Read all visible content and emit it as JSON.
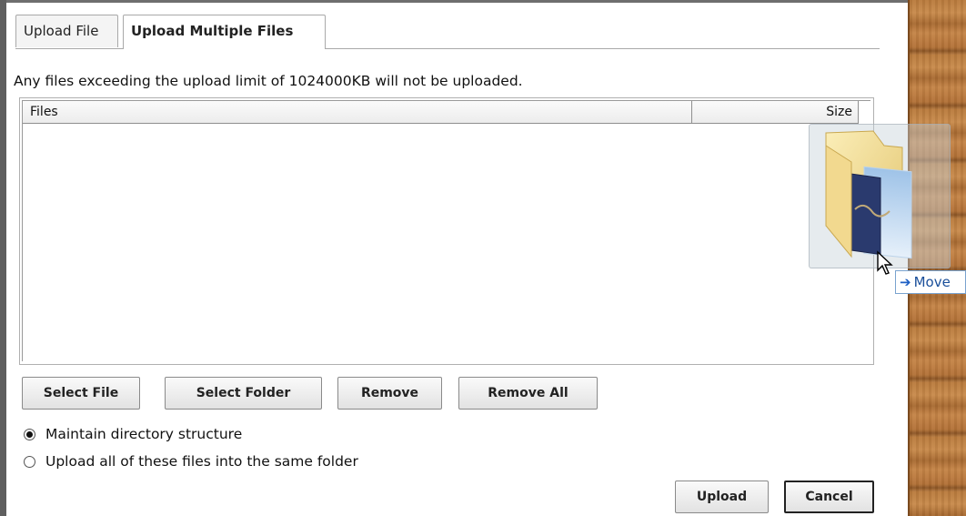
{
  "tabs": [
    {
      "label": "Upload File"
    },
    {
      "label": "Upload Multiple Files"
    }
  ],
  "notice": "Any files exceeding the upload limit of 1024000KB will not be uploaded.",
  "filelist": {
    "columns": [
      "Files",
      "Size"
    ],
    "rows": []
  },
  "buttons": {
    "select_file": "Select File",
    "select_folder": "Select Folder",
    "remove": "Remove",
    "remove_all": "Remove All",
    "upload": "Upload",
    "cancel": "Cancel"
  },
  "options": [
    {
      "label": "Maintain directory structure",
      "selected": true
    },
    {
      "label": "Upload all of these files into the same folder",
      "selected": false
    }
  ],
  "drag": {
    "tooltip": "Move",
    "icon": "folder-icon"
  }
}
